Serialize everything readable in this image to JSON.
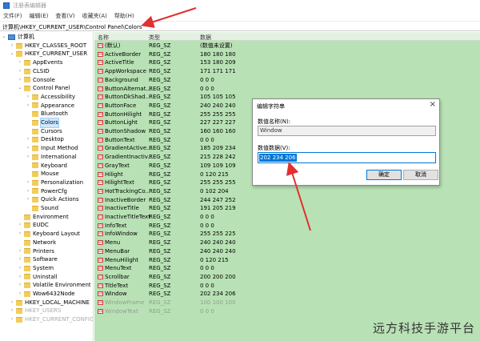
{
  "window": {
    "title": "注册表编辑器"
  },
  "menu": [
    "文件(F)",
    "编辑(E)",
    "查看(V)",
    "收藏夹(A)",
    "帮助(H)"
  ],
  "address": "计算机\\HKEY_CURRENT_USER\\Control Panel\\Colors",
  "tree": [
    {
      "label": "计算机",
      "indent": 0,
      "exp": "v",
      "icon": "pc"
    },
    {
      "label": "HKEY_CLASSES_ROOT",
      "indent": 1,
      "exp": ">",
      "icon": "folder"
    },
    {
      "label": "HKEY_CURRENT_USER",
      "indent": 1,
      "exp": "v",
      "icon": "folder"
    },
    {
      "label": "AppEvents",
      "indent": 2,
      "exp": ">",
      "icon": "folder"
    },
    {
      "label": "CLSID",
      "indent": 2,
      "exp": ">",
      "icon": "folder"
    },
    {
      "label": "Console",
      "indent": 2,
      "exp": ">",
      "icon": "folder"
    },
    {
      "label": "Control Panel",
      "indent": 2,
      "exp": "v",
      "icon": "folder"
    },
    {
      "label": "Accessibility",
      "indent": 3,
      "exp": ">",
      "icon": "folder"
    },
    {
      "label": "Appearance",
      "indent": 3,
      "exp": ">",
      "icon": "folder"
    },
    {
      "label": "Bluetooth",
      "indent": 3,
      "exp": "",
      "icon": "folder"
    },
    {
      "label": "Colors",
      "indent": 3,
      "exp": "",
      "icon": "folder",
      "selected": true
    },
    {
      "label": "Cursors",
      "indent": 3,
      "exp": "",
      "icon": "folder"
    },
    {
      "label": "Desktop",
      "indent": 3,
      "exp": ">",
      "icon": "folder"
    },
    {
      "label": "Input Method",
      "indent": 3,
      "exp": ">",
      "icon": "folder"
    },
    {
      "label": "International",
      "indent": 3,
      "exp": ">",
      "icon": "folder"
    },
    {
      "label": "Keyboard",
      "indent": 3,
      "exp": "",
      "icon": "folder"
    },
    {
      "label": "Mouse",
      "indent": 3,
      "exp": "",
      "icon": "folder"
    },
    {
      "label": "Personalization",
      "indent": 3,
      "exp": ">",
      "icon": "folder"
    },
    {
      "label": "PowerCfg",
      "indent": 3,
      "exp": ">",
      "icon": "folder"
    },
    {
      "label": "Quick Actions",
      "indent": 3,
      "exp": ">",
      "icon": "folder"
    },
    {
      "label": "Sound",
      "indent": 3,
      "exp": "",
      "icon": "folder"
    },
    {
      "label": "Environment",
      "indent": 2,
      "exp": "",
      "icon": "folder"
    },
    {
      "label": "EUDC",
      "indent": 2,
      "exp": ">",
      "icon": "folder"
    },
    {
      "label": "Keyboard Layout",
      "indent": 2,
      "exp": ">",
      "icon": "folder"
    },
    {
      "label": "Network",
      "indent": 2,
      "exp": "",
      "icon": "folder"
    },
    {
      "label": "Printers",
      "indent": 2,
      "exp": ">",
      "icon": "folder"
    },
    {
      "label": "Software",
      "indent": 2,
      "exp": ">",
      "icon": "folder"
    },
    {
      "label": "System",
      "indent": 2,
      "exp": ">",
      "icon": "folder"
    },
    {
      "label": "Uninstall",
      "indent": 2,
      "exp": ">",
      "icon": "folder"
    },
    {
      "label": "Volatile Environment",
      "indent": 2,
      "exp": ">",
      "icon": "folder"
    },
    {
      "label": "Wow6432Node",
      "indent": 2,
      "exp": ">",
      "icon": "folder"
    },
    {
      "label": "HKEY_LOCAL_MACHINE",
      "indent": 1,
      "exp": ">",
      "icon": "folder"
    },
    {
      "label": "HKEY_USERS",
      "indent": 1,
      "exp": ">",
      "icon": "folder",
      "dim": true
    },
    {
      "label": "HKEY_CURRENT_CONFIG",
      "indent": 1,
      "exp": ">",
      "icon": "folder",
      "dim": true
    }
  ],
  "list": {
    "headers": {
      "name": "名称",
      "type": "类型",
      "data": "数据"
    },
    "rows": [
      {
        "name": "(默认)",
        "type": "REG_SZ",
        "data": "(数值未设置)"
      },
      {
        "name": "ActiveBorder",
        "type": "REG_SZ",
        "data": "180 180 180"
      },
      {
        "name": "ActiveTitle",
        "type": "REG_SZ",
        "data": "153 180 209"
      },
      {
        "name": "AppWorkspace",
        "type": "REG_SZ",
        "data": "171 171 171"
      },
      {
        "name": "Background",
        "type": "REG_SZ",
        "data": "0 0 0"
      },
      {
        "name": "ButtonAlternat...",
        "type": "REG_SZ",
        "data": "0 0 0"
      },
      {
        "name": "ButtonDkShad...",
        "type": "REG_SZ",
        "data": "105 105 105"
      },
      {
        "name": "ButtonFace",
        "type": "REG_SZ",
        "data": "240 240 240"
      },
      {
        "name": "ButtonHilight",
        "type": "REG_SZ",
        "data": "255 255 255"
      },
      {
        "name": "ButtonLight",
        "type": "REG_SZ",
        "data": "227 227 227"
      },
      {
        "name": "ButtonShadow",
        "type": "REG_SZ",
        "data": "160 160 160"
      },
      {
        "name": "ButtonText",
        "type": "REG_SZ",
        "data": "0 0 0"
      },
      {
        "name": "GradientActive...",
        "type": "REG_SZ",
        "data": "185 209 234"
      },
      {
        "name": "GradientInactiv...",
        "type": "REG_SZ",
        "data": "215 228 242"
      },
      {
        "name": "GrayText",
        "type": "REG_SZ",
        "data": "109 109 109"
      },
      {
        "name": "Hilight",
        "type": "REG_SZ",
        "data": "0 120 215"
      },
      {
        "name": "HilightText",
        "type": "REG_SZ",
        "data": "255 255 255"
      },
      {
        "name": "HotTrackingCo...",
        "type": "REG_SZ",
        "data": "0 102 204"
      },
      {
        "name": "InactiveBorder",
        "type": "REG_SZ",
        "data": "244 247 252"
      },
      {
        "name": "InactiveTitle",
        "type": "REG_SZ",
        "data": "191 205 219"
      },
      {
        "name": "InactiveTitleText",
        "type": "REG_SZ",
        "data": "0 0 0"
      },
      {
        "name": "InfoText",
        "type": "REG_SZ",
        "data": "0 0 0"
      },
      {
        "name": "InfoWindow",
        "type": "REG_SZ",
        "data": "255 255 225"
      },
      {
        "name": "Menu",
        "type": "REG_SZ",
        "data": "240 240 240"
      },
      {
        "name": "MenuBar",
        "type": "REG_SZ",
        "data": "240 240 240"
      },
      {
        "name": "MenuHilight",
        "type": "REG_SZ",
        "data": "0 120 215"
      },
      {
        "name": "MenuText",
        "type": "REG_SZ",
        "data": "0 0 0"
      },
      {
        "name": "Scrollbar",
        "type": "REG_SZ",
        "data": "200 200 200"
      },
      {
        "name": "TitleText",
        "type": "REG_SZ",
        "data": "0 0 0"
      },
      {
        "name": "Window",
        "type": "REG_SZ",
        "data": "202 234 206"
      },
      {
        "name": "WindowFrame",
        "type": "REG_SZ",
        "data": "100 100 100",
        "dim": true
      },
      {
        "name": "WindowText",
        "type": "REG_SZ",
        "data": "0 0 0",
        "dim": true
      }
    ]
  },
  "dialog": {
    "title": "编辑字符串",
    "name_label": "数值名称(N):",
    "name_value": "Window",
    "data_label": "数值数据(V):",
    "data_value": "202 234 206",
    "ok": "确定",
    "cancel": "取消"
  },
  "watermark": "远方科技手游平台",
  "colors": {
    "list_bg": "#b8e2b5",
    "arrow": "#e03030",
    "accent": "#0078d7"
  }
}
